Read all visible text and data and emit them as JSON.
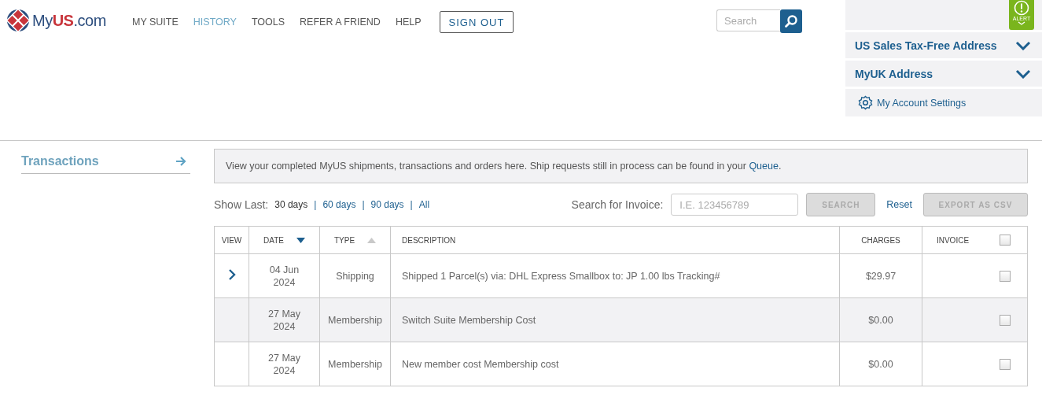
{
  "logo": {
    "text_my": "My",
    "text_us": "US",
    "text_com": ".com"
  },
  "nav": [
    {
      "label": "MY SUITE",
      "selected": false
    },
    {
      "label": "HISTORY",
      "selected": true
    },
    {
      "label": "TOOLS",
      "selected": false
    },
    {
      "label": "REFER A FRIEND",
      "selected": false
    },
    {
      "label": "HELP",
      "selected": false
    }
  ],
  "sign_out": "SIGN OUT",
  "search": {
    "placeholder": "Search"
  },
  "account_panel": {
    "alert": "ALERT",
    "sections": [
      {
        "label": "US Sales Tax-Free Address",
        "expanded": false
      },
      {
        "label": "MyUK Address",
        "expanded": false
      }
    ],
    "settings": "My Account Settings"
  },
  "sidebar": {
    "title": "Transactions"
  },
  "notice": {
    "text": "View your completed MyUS shipments, transactions and orders here. Ship requests still in process can be found in your ",
    "link": "Queue",
    "end": "."
  },
  "show_last": {
    "label": "Show Last:",
    "separator": "|",
    "options": [
      {
        "label": "30 days",
        "selected": true
      },
      {
        "label": "60 days",
        "selected": false
      },
      {
        "label": "90 days",
        "selected": false
      },
      {
        "label": "All",
        "selected": false
      }
    ]
  },
  "invoice_search": {
    "label": "Search for Invoice:",
    "placeholder": "I.E. 123456789",
    "search_button": {
      "label": "SEARCH",
      "disabled": true
    },
    "reset": "Reset",
    "export_button": {
      "label": "EXPORT AS CSV",
      "disabled": true
    }
  },
  "table": {
    "columns": [
      {
        "label": "VIEW"
      },
      {
        "label": "DATE",
        "sort_descending": true,
        "sort_active": true
      },
      {
        "label": "TYPE",
        "sort_descending": false,
        "sort_active": false
      },
      {
        "label": "DESCRIPTION"
      },
      {
        "label": "CHARGES"
      },
      {
        "label": "INVOICE"
      }
    ],
    "select_all": {
      "checked": false
    },
    "rows": [
      {
        "expandable": true,
        "date": "04 Jun",
        "year": "2024",
        "type": "Shipping",
        "description": "Shipped 1 Parcel(s) via: DHL Express Smallbox to: JP 1.00 lbs Tracking#",
        "charges": "$29.97",
        "checked": false
      },
      {
        "expandable": false,
        "date": "27 May",
        "year": "2024",
        "type": "Membership",
        "description": "Switch Suite Membership Cost",
        "charges": "$0.00",
        "checked": false
      },
      {
        "expandable": false,
        "date": "27 May",
        "year": "2024",
        "type": "Membership",
        "description": "New member cost Membership cost",
        "charges": "$0.00",
        "checked": false
      }
    ]
  }
}
